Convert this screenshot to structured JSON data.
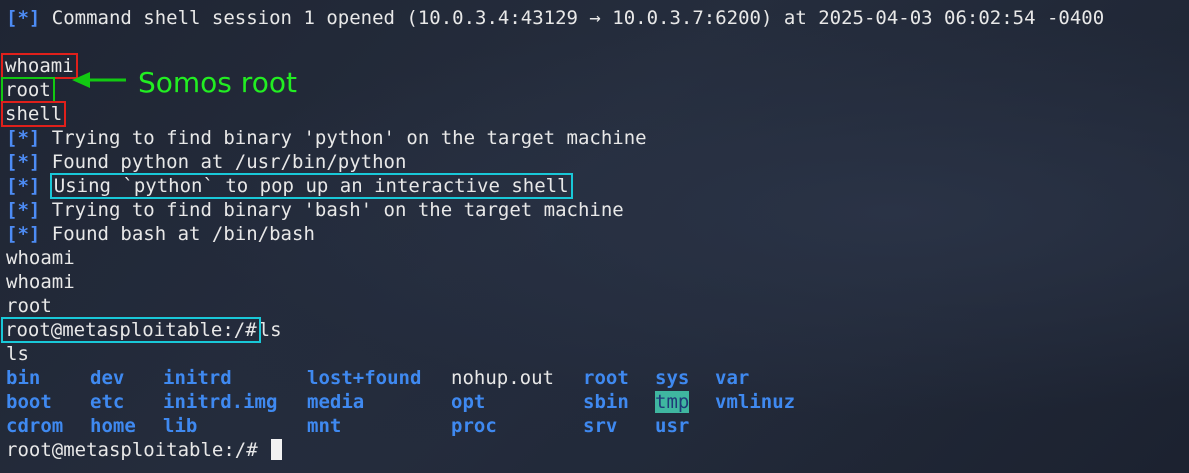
{
  "session": {
    "tag": "[*]",
    "opened_text": "Command shell session 1 opened (10.0.3.4:43129 → 10.0.3.7:6200) at 2025-04-03 06:02:54 -0400"
  },
  "commands": {
    "whoami_input": "whoami",
    "root_output": "root",
    "shell_input": "shell"
  },
  "annotation": {
    "text": "Somos root",
    "color": "#22ee22"
  },
  "messages": [
    {
      "tag": "[*]",
      "text": "Trying to find binary 'python' on the target machine"
    },
    {
      "tag": "[*]",
      "text": "Found python at /usr/bin/python"
    },
    {
      "tag": "[*]",
      "text": "Using `python` to pop up an interactive shell"
    },
    {
      "tag": "[*]",
      "text": "Trying to find binary 'bash' on the target machine"
    },
    {
      "tag": "[*]",
      "text": "Found bash at /bin/bash"
    }
  ],
  "output_lines": [
    "whoami",
    "whoami",
    "root"
  ],
  "prompt": {
    "text": "root@metasploitable:/#",
    "command": "ls",
    "echo": "ls"
  },
  "ls_entries": [
    "bin",
    "dev",
    "initrd",
    "lost+found",
    "nohup.out",
    "root",
    "sys",
    "var",
    "boot",
    "etc",
    "initrd.img",
    "media",
    "opt",
    "sbin",
    "tmp",
    "vmlinuz",
    "cdrom",
    "home",
    "lib",
    "mnt",
    "proc",
    "srv",
    "usr"
  ],
  "final_prompt": "root@metasploitable:/#",
  "colors": {
    "tag_blue": "#4d8cf5",
    "dir_blue": "#3f89f0",
    "box_red": "#e0201b",
    "box_green": "#12c912",
    "box_cyan": "#19c8d8",
    "sticky_bg": "#3fb6a0"
  }
}
